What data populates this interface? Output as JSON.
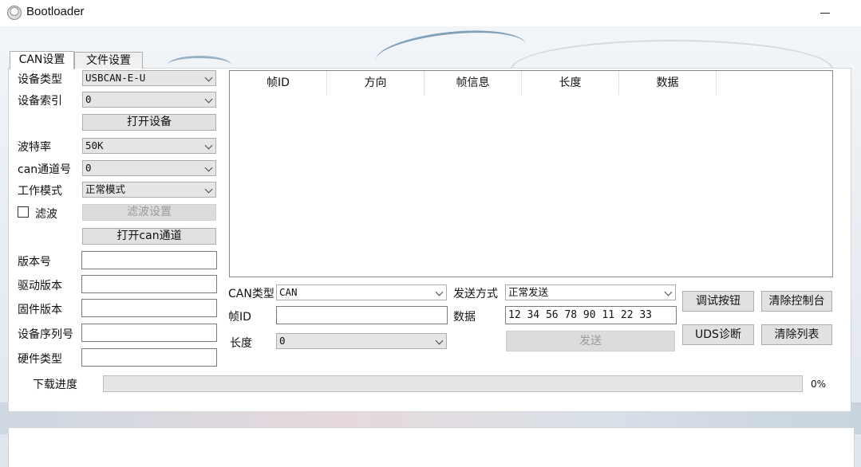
{
  "window": {
    "title": "Bootloader"
  },
  "tabs": [
    {
      "label": "CAN设置"
    },
    {
      "label": "文件设置"
    }
  ],
  "can": {
    "device_type_label": "设备类型",
    "device_type_value": "USBCAN-E-U",
    "device_index_label": "设备索引",
    "device_index_value": "0",
    "open_device_label": "打开设备",
    "baud_label": "波特率",
    "baud_value": "50K",
    "channel_label": "can通道号",
    "channel_value": "0",
    "mode_label": "工作模式",
    "mode_value": "正常模式",
    "filter_label": "滤波",
    "filter_checked": false,
    "filter_settings_label": "滤波设置",
    "open_channel_label": "打开can通道"
  },
  "info": {
    "version_label": "版本号",
    "version_value": "",
    "driver_version_label": "驱动版本",
    "driver_version_value": "",
    "firmware_version_label": "固件版本",
    "firmware_version_value": "",
    "serial_label": "设备序列号",
    "serial_value": "",
    "hardware_type_label": "硬件类型",
    "hardware_type_value": ""
  },
  "grid": {
    "columns": [
      "帧ID",
      "方向",
      "帧信息",
      "长度",
      "数据"
    ]
  },
  "send": {
    "can_type_label": "CAN类型",
    "can_type_value": "CAN",
    "send_mode_label": "发送方式",
    "send_mode_value": "正常发送",
    "frame_id_label": "帧ID",
    "frame_id_value": "",
    "data_label": "数据",
    "data_value": "12 34 56 78 90 11 22 33",
    "length_label": "长度",
    "length_value": "0",
    "send_button": "发送",
    "debug_button": "调试按钮",
    "clear_console_button": "清除控制台",
    "uds_button": "UDS诊断",
    "clear_list_button": "清除列表"
  },
  "progress": {
    "label": "下载进度",
    "percent_text": "0%",
    "value": 0
  },
  "colors": {
    "progress_fill": "#06b025",
    "accent_line": "#4f7ea0"
  }
}
